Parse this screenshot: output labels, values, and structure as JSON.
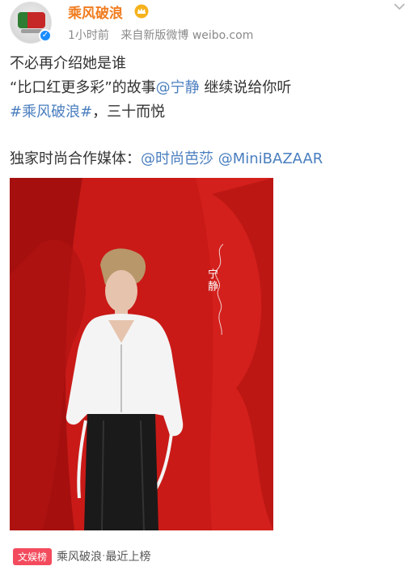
{
  "post": {
    "author": "乘风破浪",
    "time": "1小时前",
    "source": "来自新版微博 weibo.com",
    "line1": "不必再介绍她是谁",
    "line2_pre": "“比口红更多彩”的故事",
    "mention1": "@宁静",
    "line2_post": " 继续说给你听",
    "hashtag": "#乘风破浪#",
    "line3_post": "，三十而悦",
    "line4_pre": "独家时尚合作媒体：",
    "mention2": "@时尚芭莎",
    "mention3": "@MiniBAZAAR"
  },
  "photo": {
    "caption": "宁静"
  },
  "footer": {
    "tag": "文娱榜",
    "topic": "乘风破浪",
    "status": "最近上榜"
  },
  "colors": {
    "username": "#f07c1f",
    "link": "#4a7ebf",
    "photo_bg": "#c91a17",
    "verified_badge": "#1a8cff",
    "rank_tag": "#f34b5d"
  },
  "icons": [
    "avatar",
    "verified-icon",
    "crown-icon",
    "chevron-down-icon"
  ]
}
